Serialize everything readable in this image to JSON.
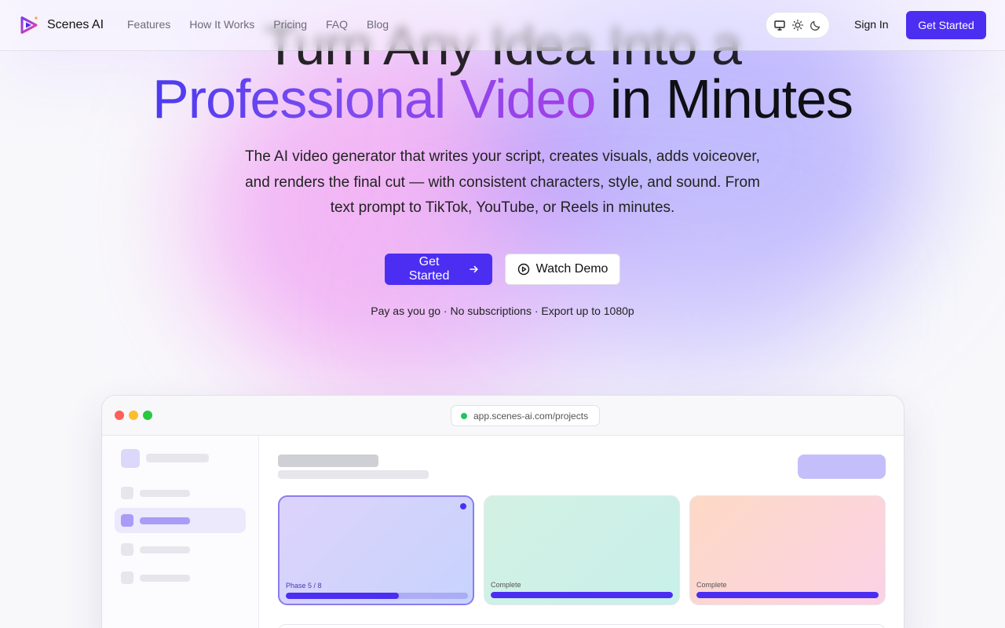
{
  "brand": {
    "name": "Scenes AI"
  },
  "nav": {
    "links": [
      "Features",
      "How It Works",
      "Pricing",
      "FAQ",
      "Blog"
    ],
    "theme_icons": [
      "monitor-icon",
      "sun-icon",
      "moon-icon"
    ],
    "sign_in": "Sign In",
    "cta": "Get Started"
  },
  "hero": {
    "headline_line1": "Turn Any Idea Into a",
    "headline_gradient": "Professional Video",
    "headline_rest": " in Minutes",
    "subtitle": "The AI video generator that writes your script, creates visuals, adds voiceover, and renders the final cut — with consistent characters, style, and sound. From text prompt to TikTok, YouTube, or Reels in minutes.",
    "primary_cta": "Get Started",
    "secondary_cta": "Watch Demo",
    "tagline": "Pay as you go · No subscriptions · Export up to 1080p"
  },
  "preview": {
    "url": "app.scenes-ai.com/projects",
    "cards": [
      {
        "label": "Phase 5 / 8",
        "progress": 0.62
      },
      {
        "label": "Complete",
        "progress": 1.0
      },
      {
        "label": "Complete",
        "progress": 1.0
      }
    ]
  },
  "colors": {
    "accent": "#4b2ef2",
    "gradient_start": "#4b3af0",
    "gradient_end": "#a63ee6"
  }
}
